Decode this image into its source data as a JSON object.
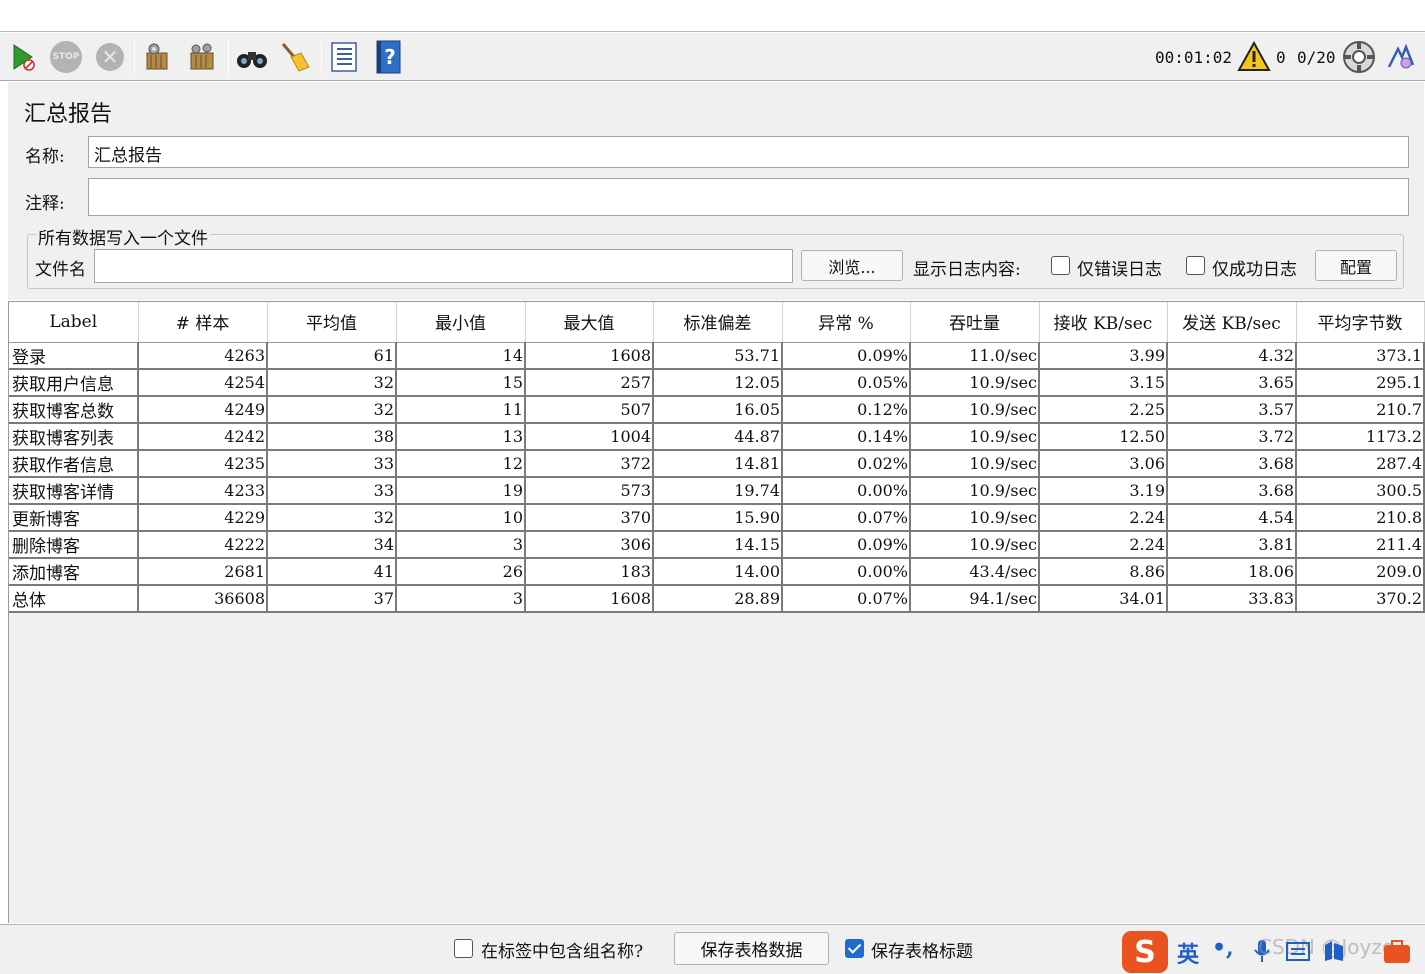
{
  "toolbar": {
    "stop_icon_text": "STOP",
    "elapsed_time": "00:01:02",
    "warning_count": "0",
    "threads": "0/20"
  },
  "panel": {
    "title": "汇总报告",
    "name_label": "名称:",
    "name_value": "汇总报告",
    "comment_label": "注释:",
    "comment_value": "",
    "file_group_title": "所有数据写入一个文件",
    "filename_label": "文件名",
    "filename_value": "",
    "browse_button": "浏览...",
    "log_display_label": "显示日志内容:",
    "errors_only_label": "仅错误日志",
    "success_only_label": "仅成功日志",
    "configure_button": "配置"
  },
  "table": {
    "headers": [
      "Label",
      "# 样本",
      "平均值",
      "最小值",
      "最大值",
      "标准偏差",
      "异常 %",
      "吞吐量",
      "接收 KB/sec",
      "发送 KB/sec",
      "平均字节数"
    ],
    "rows": [
      [
        "登录",
        "4263",
        "61",
        "14",
        "1608",
        "53.71",
        "0.09%",
        "11.0/sec",
        "3.99",
        "4.32",
        "373.1"
      ],
      [
        "获取用户信息",
        "4254",
        "32",
        "15",
        "257",
        "12.05",
        "0.05%",
        "10.9/sec",
        "3.15",
        "3.65",
        "295.1"
      ],
      [
        "获取博客总数",
        "4249",
        "32",
        "11",
        "507",
        "16.05",
        "0.12%",
        "10.9/sec",
        "2.25",
        "3.57",
        "210.7"
      ],
      [
        "获取博客列表",
        "4242",
        "38",
        "13",
        "1004",
        "44.87",
        "0.14%",
        "10.9/sec",
        "12.50",
        "3.72",
        "1173.2"
      ],
      [
        "获取作者信息",
        "4235",
        "33",
        "12",
        "372",
        "14.81",
        "0.02%",
        "10.9/sec",
        "3.06",
        "3.68",
        "287.4"
      ],
      [
        "获取博客详情",
        "4233",
        "33",
        "19",
        "573",
        "19.74",
        "0.00%",
        "10.9/sec",
        "3.19",
        "3.68",
        "300.5"
      ],
      [
        "更新博客",
        "4229",
        "32",
        "10",
        "370",
        "15.90",
        "0.07%",
        "10.9/sec",
        "2.24",
        "4.54",
        "210.8"
      ],
      [
        "删除博客",
        "4222",
        "34",
        "3",
        "306",
        "14.15",
        "0.09%",
        "10.9/sec",
        "2.24",
        "3.81",
        "211.4"
      ],
      [
        "添加博客",
        "2681",
        "41",
        "26",
        "183",
        "14.00",
        "0.00%",
        "43.4/sec",
        "8.86",
        "18.06",
        "209.0"
      ],
      [
        "总体",
        "36608",
        "37",
        "3",
        "1608",
        "28.89",
        "0.07%",
        "94.1/sec",
        "34.01",
        "33.83",
        "370.2"
      ]
    ]
  },
  "bottom": {
    "include_group_label": "在标签中包含组名称?",
    "include_group_checked": false,
    "save_table_button": "保存表格数据",
    "save_header_label": "保存表格标题",
    "save_header_checked": true
  },
  "ime": {
    "logo": "S",
    "mode": "英",
    "watermark": "CSDN @Joyze"
  }
}
